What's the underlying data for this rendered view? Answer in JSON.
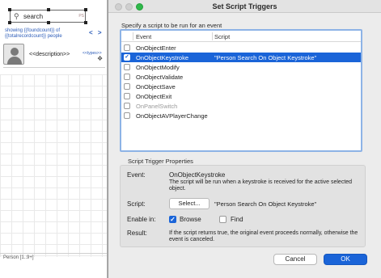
{
  "canvas": {
    "search_placeholder": "search",
    "search_tag": "PS",
    "found_text": "showing {{foundcount}} of {{totalrecordcount}} people",
    "nav_arrows": "< >",
    "description_placeholder": "<<description>>",
    "types_label": "<<types>>",
    "footer": "Person [1..9+]"
  },
  "dialog": {
    "title": "Set Script Triggers",
    "instruction": "Specify a script to be run for an event",
    "columns": {
      "event": "Event",
      "script": "Script"
    },
    "events": [
      {
        "name": "OnObjectEnter",
        "script": "",
        "checked": false,
        "selected": false,
        "enabled": true
      },
      {
        "name": "OnObjectKeystroke",
        "script": "\"Person Search On Object Keystroke\"",
        "checked": true,
        "selected": true,
        "enabled": true
      },
      {
        "name": "OnObjectModify",
        "script": "",
        "checked": false,
        "selected": false,
        "enabled": true
      },
      {
        "name": "OnObjectValidate",
        "script": "",
        "checked": false,
        "selected": false,
        "enabled": true
      },
      {
        "name": "OnObjectSave",
        "script": "",
        "checked": false,
        "selected": false,
        "enabled": true
      },
      {
        "name": "OnObjectExit",
        "script": "",
        "checked": false,
        "selected": false,
        "enabled": true
      },
      {
        "name": "OnPanelSwitch",
        "script": "",
        "checked": false,
        "selected": false,
        "enabled": false
      },
      {
        "name": "OnObjectAVPlayerChange",
        "script": "",
        "checked": false,
        "selected": false,
        "enabled": true
      }
    ],
    "properties": {
      "section_label": "Script Trigger Properties",
      "event_label": "Event:",
      "event_value": "OnObjectKeystroke",
      "event_description": "The script will be run when a keystroke is received for the active selected object.",
      "script_label": "Script:",
      "select_button": "Select...",
      "script_value": "\"Person Search On Object Keystroke\"",
      "enable_label": "Enable in:",
      "browse_label": "Browse",
      "browse_checked": true,
      "find_label": "Find",
      "find_checked": false,
      "result_label": "Result:",
      "result_text": "If the script returns true, the original event proceeds normally, otherwise the event is canceled."
    },
    "buttons": {
      "cancel": "Cancel",
      "ok": "OK"
    },
    "colors": {
      "selection": "#1a64d8",
      "list_focus_ring": "#8db3e6",
      "zoom_light": "#2fb84a"
    }
  }
}
